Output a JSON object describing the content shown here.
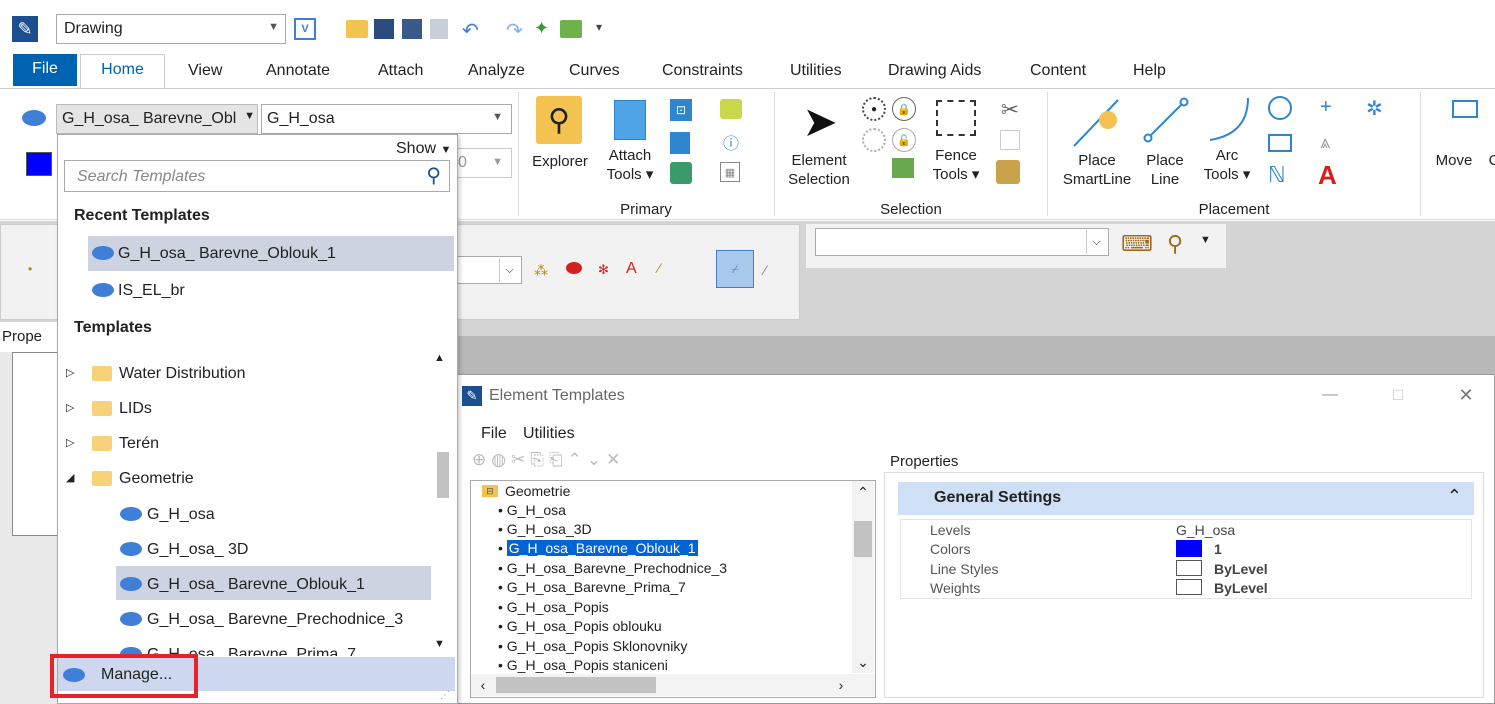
{
  "qat": {
    "workflow": "Drawing"
  },
  "tabs": [
    "File",
    "Home",
    "View",
    "Annotate",
    "Attach",
    "Analyze",
    "Curves",
    "Constraints",
    "Utilities",
    "Drawing Aids",
    "Content",
    "Help"
  ],
  "ribbon": {
    "template_combo": "G_H_osa_ Barevne_Obl ",
    "level_combo": "G_H_osa",
    "explorer": "Explorer",
    "attach_tools": [
      "Attach",
      "Tools ▾"
    ],
    "primary_group": "Primary",
    "element_selection": [
      "Element",
      "Selection"
    ],
    "fence_tools": [
      "Fence",
      "Tools ▾"
    ],
    "selection_group": "Selection",
    "place_smartline": [
      "Place",
      "SmartLine"
    ],
    "place_line": [
      "Place",
      "Line"
    ],
    "arc_tools": [
      "Arc",
      "Tools ▾"
    ],
    "placement_group": "Placement",
    "move": "Move",
    "move_more": "C",
    "weight_partial": "0"
  },
  "dropdown": {
    "show_label": "Show",
    "search_placeholder": "Search Templates",
    "recent_header": "Recent Templates",
    "recent": [
      "G_H_osa_ Barevne_Oblouk_1",
      "IS_EL_br"
    ],
    "templates_header": "Templates",
    "folders": [
      "Water Distribution",
      "LIDs",
      "Terén",
      "Geometrie"
    ],
    "geometrie_children": [
      "G_H_osa",
      "G_H_osa_ 3D",
      "G_H_osa_ Barevne_Oblouk_1",
      "G_H_osa_ Barevne_Prechodnice_3",
      "G_H_osa_ Barevne_Prima_7"
    ],
    "manage": "Manage..."
  },
  "properties_panel": {
    "label": "Prope"
  },
  "element_templates": {
    "title": "Element Templates",
    "menu": [
      "File",
      "Utilities"
    ],
    "tree_root": "Geometrie",
    "tree_items": [
      "G_H_osa",
      "G_H_osa_3D",
      "G_H_osa_Barevne_Oblouk_1",
      "G_H_osa_Barevne_Prechodnice_3",
      "G_H_osa_Barevne_Prima_7",
      "G_H_osa_Popis",
      "G_H_osa_Popis oblouku",
      "G_H_osa_Popis Sklonovniky",
      "G_H_osa_Popis staniceni"
    ],
    "properties_label": "Properties",
    "section": "General Settings",
    "props": [
      {
        "name": "Levels",
        "value": "G_H_osa"
      },
      {
        "name": "Colors",
        "value": "1"
      },
      {
        "name": "Line Styles",
        "value": "ByLevel"
      },
      {
        "name": "Weights",
        "value": "ByLevel"
      }
    ]
  },
  "colors": {
    "accent": "#0063b1",
    "active_color": "#0000ff",
    "highlight": "#cdd3e0",
    "manage_border": "#e8212b"
  }
}
